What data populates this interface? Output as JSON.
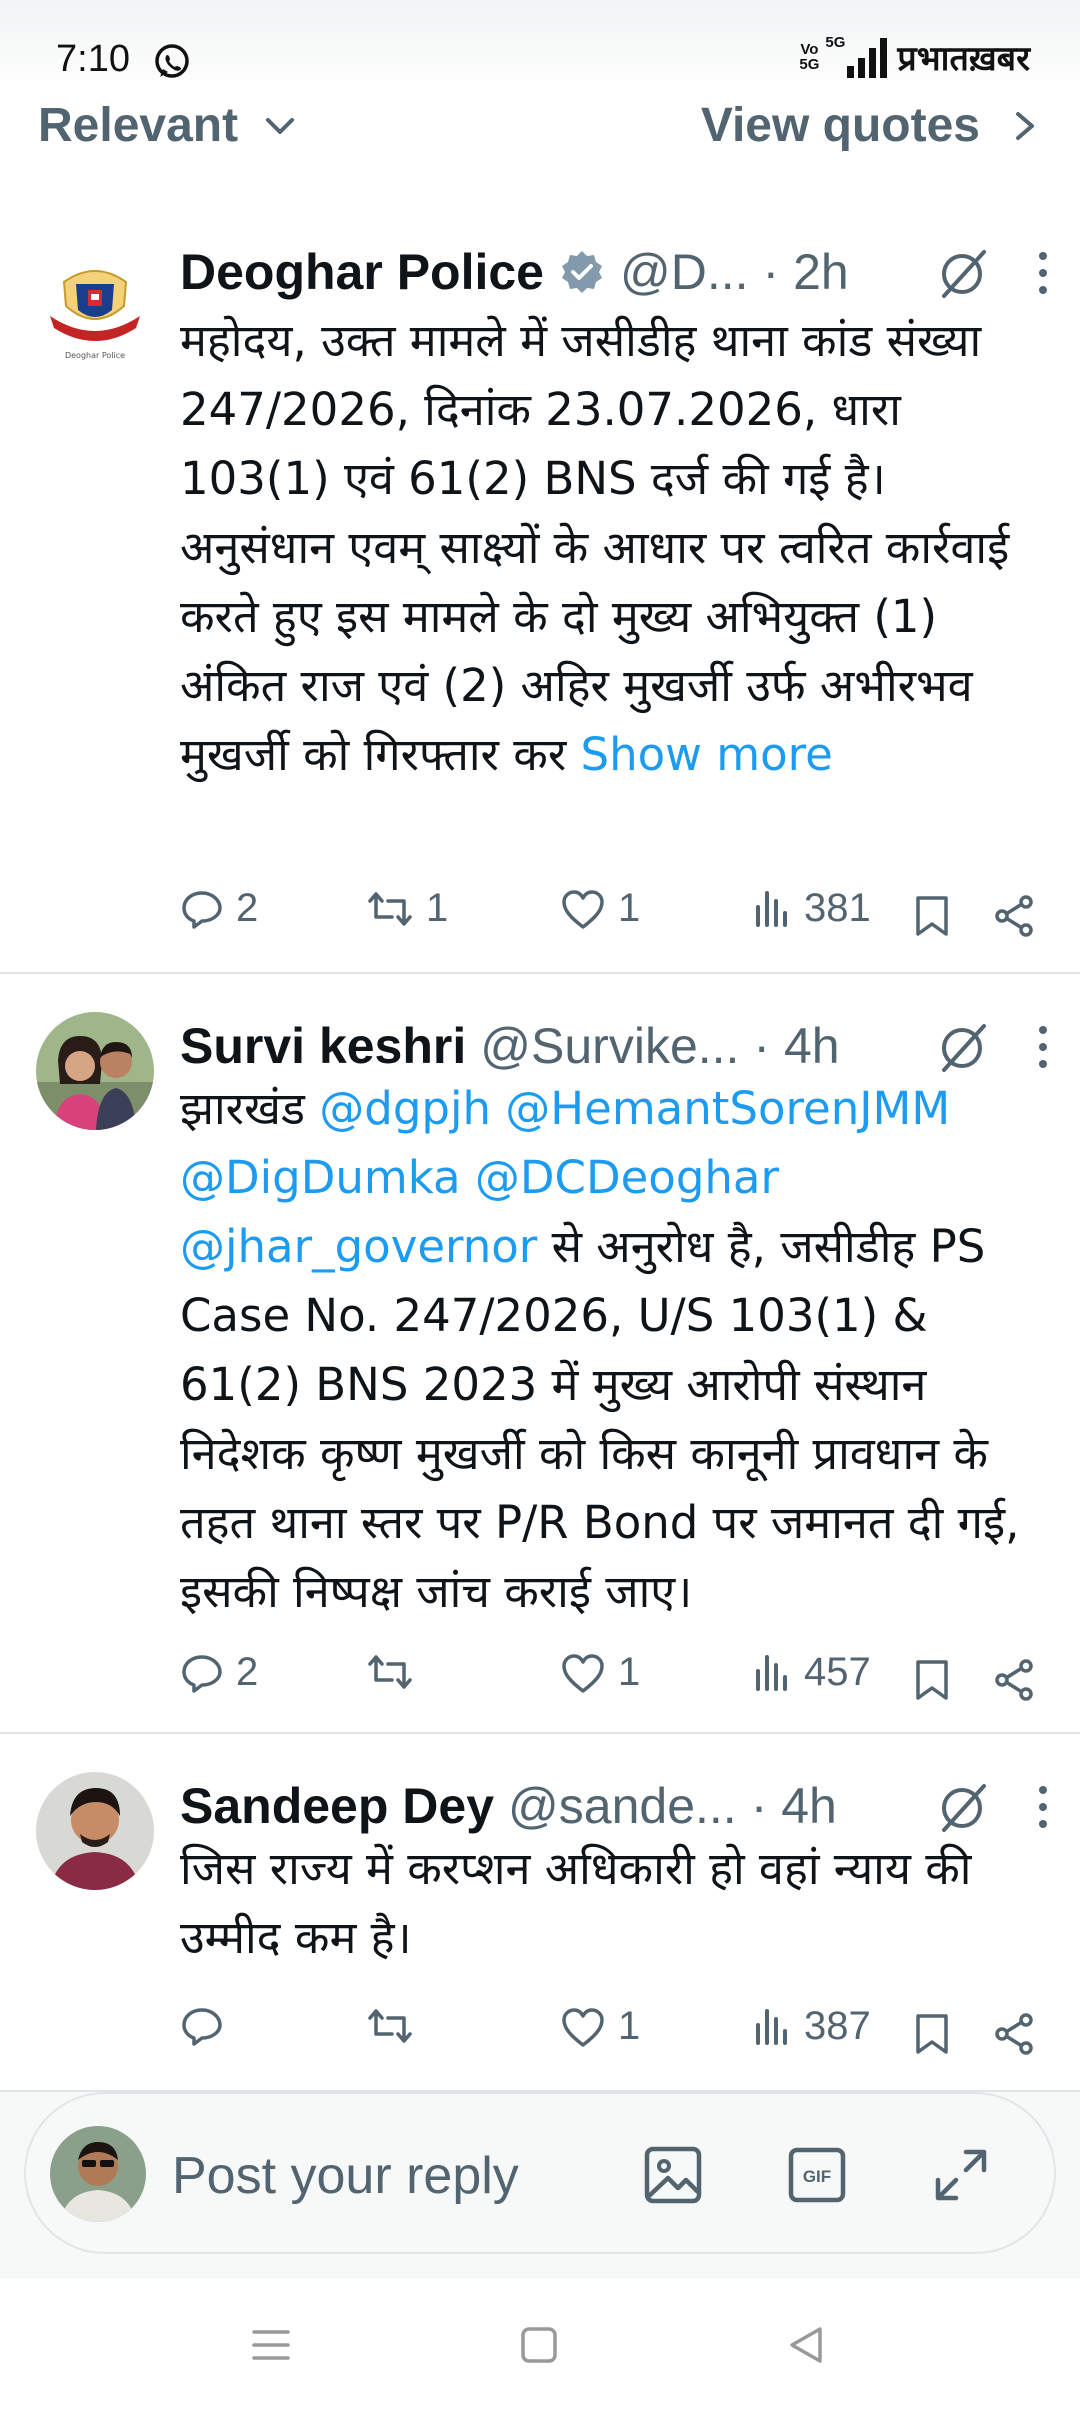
{
  "status_bar": {
    "time": "7:10",
    "network_label": "5G",
    "volte_top": "Vo",
    "volte_bottom": "5G",
    "brand": "प्रभातख़बर"
  },
  "filter": {
    "sort_label": "Relevant",
    "quotes_label": "View quotes"
  },
  "tweets": [
    {
      "name": "Deoghar Police",
      "verified": true,
      "handle": "@D...",
      "time": "· 2h",
      "body": "महोदय, उक्त मामले में जसीडीह थाना कांड संख्या 247/2026, दिनांक 23.07.2026, धारा 103(1) एवं 61(2) BNS दर्ज की गई है। अनुसंधान एवम् साक्ष्यों के आधार पर त्वरित कार्रवाई करते हुए इस मामले के दो मुख्य अभियुक्त (1) अंकित राज एवं (2) अहिर मुखर्जी उर्फ अभीरभव मुखर्जी को गिरफ्तार कर",
      "show_more": "Show more",
      "replies": "2",
      "reposts": "1",
      "likes": "1",
      "views": "381"
    },
    {
      "name": "Survi keshri",
      "handle": "@Survike...",
      "time": "· 4h",
      "body_prefix": "झारखंड ",
      "mentions_line1": "@dgpjh @HemantSorenJMM",
      "mentions_line2": "@DigDumka @DCDeoghar",
      "mentions_line3": "@jhar_governor",
      "body": " से अनुरोध है, जसीडीह PS Case No. 247/2026, U/S 103(1) & 61(2) BNS 2023 में मुख्य आरोपी संस्थान निदेशक कृष्ण मुखर्जी को किस कानूनी प्रावधान के तहत थाना स्तर पर P/R Bond पर जमानत दी गई, इसकी निष्पक्ष जांच कराई जाए।",
      "replies": "2",
      "reposts": "",
      "likes": "1",
      "views": "457"
    },
    {
      "name": "Sandeep Dey",
      "handle": "@sande...",
      "time": "· 4h",
      "body": "जिस राज्य में करप्शन अधिकारी हो वहां न्याय की उम्मीद कम है।",
      "replies": "",
      "reposts": "",
      "likes": "1",
      "views": "387"
    }
  ],
  "reply_bar": {
    "placeholder": "Post your reply",
    "gif_label": "GIF"
  },
  "colors": {
    "accent": "#1d9bf0",
    "muted": "#536471",
    "text": "#0f1419"
  }
}
